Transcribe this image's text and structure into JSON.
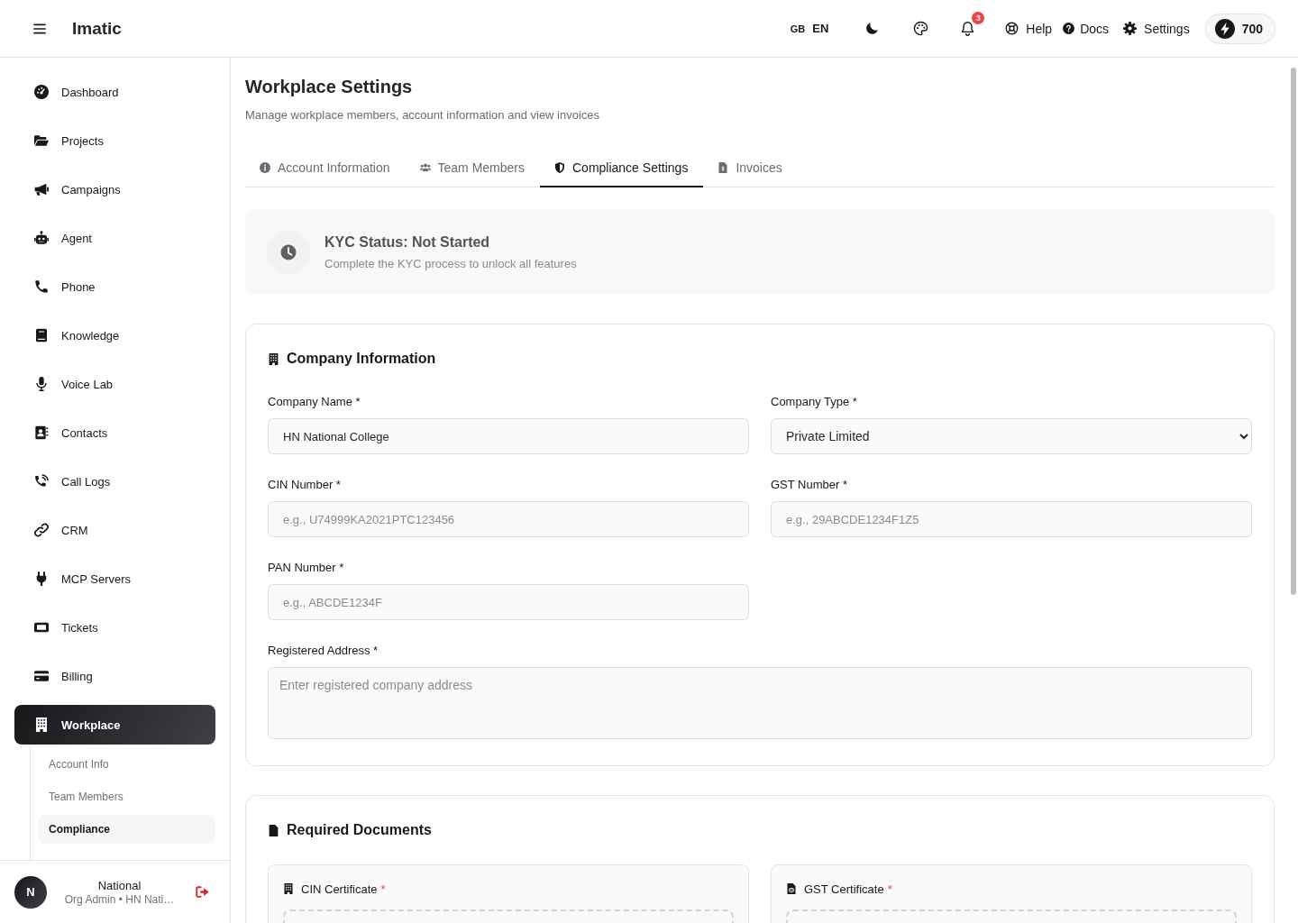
{
  "header": {
    "brand": "Imatic",
    "language": {
      "flag": "GB",
      "code": "EN"
    },
    "notification_count": "3",
    "links": [
      "Help",
      "Docs",
      "Settings"
    ],
    "credits": "700"
  },
  "sidebar": {
    "items": [
      {
        "label": "Dashboard",
        "selected": false
      },
      {
        "label": "Projects",
        "selected": false
      },
      {
        "label": "Campaigns",
        "selected": false
      },
      {
        "label": "Agent",
        "selected": false
      },
      {
        "label": "Phone",
        "selected": false
      },
      {
        "label": "Knowledge",
        "selected": false
      },
      {
        "label": "Voice Lab",
        "selected": false
      },
      {
        "label": "Contacts",
        "selected": false
      },
      {
        "label": "Call Logs",
        "selected": false
      },
      {
        "label": "CRM",
        "selected": false
      },
      {
        "label": "MCP Servers",
        "selected": false
      },
      {
        "label": "Tickets",
        "selected": false
      },
      {
        "label": "Billing",
        "selected": false
      },
      {
        "label": "Workplace",
        "selected": true,
        "children": [
          {
            "label": "Account Info",
            "selected": false
          },
          {
            "label": "Team Members",
            "selected": false
          },
          {
            "label": "Compliance",
            "selected": true
          }
        ]
      }
    ],
    "user": {
      "initial": "N",
      "name": "National",
      "role": "Org Admin • HN Nati…"
    }
  },
  "page": {
    "title": "Workplace Settings",
    "subtitle": "Manage workplace members, account information and view invoices"
  },
  "tabs": [
    {
      "label": "Account Information",
      "selected": false
    },
    {
      "label": "Team Members",
      "selected": false
    },
    {
      "label": "Compliance Settings",
      "selected": true
    },
    {
      "label": "Invoices",
      "selected": false
    }
  ],
  "kyc": {
    "title": "KYC Status: Not Started",
    "message": "Complete the KYC process to unlock all features"
  },
  "company_information": {
    "title": "Company Information",
    "fields": [
      {
        "kind": "text",
        "label": "Company Name *",
        "value": "HN National College"
      },
      {
        "kind": "select",
        "label": "Company Type *",
        "value": "Private Limited"
      },
      {
        "kind": "text",
        "label": "CIN Number *",
        "placeholder": "e.g., U74999KA2021PTC123456"
      },
      {
        "kind": "text",
        "label": "GST Number *",
        "placeholder": "e.g., 29ABCDE1234F1Z5"
      },
      {
        "kind": "text",
        "label": "PAN Number *",
        "placeholder": "e.g., ABCDE1234F"
      },
      {
        "kind": "textarea",
        "label": "Registered Address *",
        "placeholder": "Enter registered company address"
      }
    ]
  },
  "required_documents": {
    "title": "Required Documents",
    "documents": [
      {
        "label": "CIN Certificate",
        "mark": "*"
      },
      {
        "label": "GST Certificate",
        "mark": "*"
      }
    ]
  }
}
